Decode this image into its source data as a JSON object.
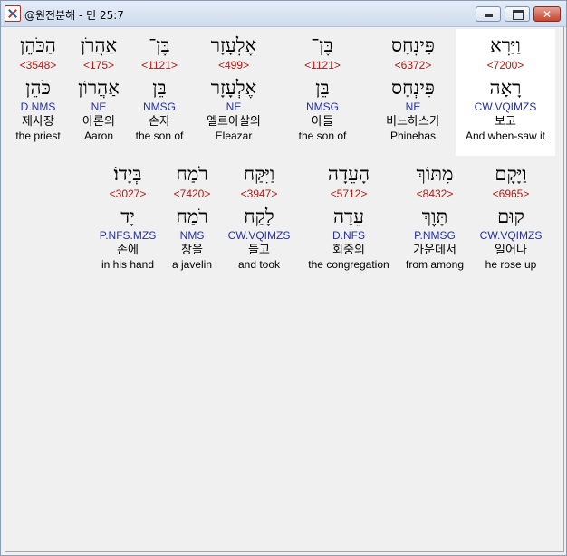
{
  "window": {
    "title": "@원전분해 - 민 25:7",
    "minimize_glyph": "",
    "maximize_glyph": "",
    "close_glyph": "✕"
  },
  "verse": {
    "line1": [
      {
        "heb": "וַיַּרְא",
        "strong": "<7200>",
        "lemma": "רָאָה",
        "parse": "CW.VQIMZS",
        "kor": "보고",
        "eng": "And when-saw it"
      },
      {
        "heb": "פִּינְחָס",
        "strong": "<6372>",
        "lemma": "פִּינְחָס",
        "parse": "NE",
        "kor": "비느하스가",
        "eng": "Phinehas"
      },
      {
        "heb": "בֶּן־",
        "strong": "<1121>",
        "lemma": "בֵּן",
        "parse": "NMSG",
        "kor": "아들",
        "eng": "the son of"
      },
      {
        "heb": "אֶלְעָזָר",
        "strong": "<499>",
        "lemma": "אֶלְעָזָר",
        "parse": "NE",
        "kor": "엘르아살의",
        "eng": "Eleazar"
      },
      {
        "heb": "בֶּן־",
        "strong": "<1121>",
        "lemma": "בֵּן",
        "parse": "NMSG",
        "kor": "손자",
        "eng": "the son of"
      },
      {
        "heb": "אַהֲרֹן",
        "strong": "<175>",
        "lemma": "אַהֲרוֹן",
        "parse": "NE",
        "kor": "아론의",
        "eng": "Aaron"
      },
      {
        "heb": "הַכֹּהֵן",
        "strong": "<3548>",
        "lemma": "כֹּהֵן",
        "parse": "D.NMS",
        "kor": "제사장",
        "eng": "the priest"
      }
    ],
    "line2": [
      {
        "heb": "וַיָּקָם",
        "strong": "<6965>",
        "lemma": "קוּם",
        "parse": "CW.VQIMZS",
        "kor": "일어나",
        "eng": "he rose up"
      },
      {
        "heb": "מִתּוֹךְ",
        "strong": "<8432>",
        "lemma": "תָּוֶךְ",
        "parse": "P.NMSG",
        "kor": "가운데서",
        "eng": "from among"
      },
      {
        "heb": "הָעֵדָה",
        "strong": "<5712>",
        "lemma": "עֵדָה",
        "parse": "D.NFS",
        "kor": "회중의",
        "eng": "the congregation"
      },
      {
        "heb": "וַיִּקַּח",
        "strong": "<3947>",
        "lemma": "לָקַח",
        "parse": "CW.VQIMZS",
        "kor": "들고",
        "eng": "and took"
      },
      {
        "heb": "רֹמַח",
        "strong": "<7420>",
        "lemma": "רֹמַח",
        "parse": "NMS",
        "kor": "창을",
        "eng": "a javelin"
      },
      {
        "heb": "בְּיָדוֹ׃",
        "strong": "<3027>",
        "lemma": "יָד",
        "parse": "P.NFS.MZS",
        "kor": "손에",
        "eng": "in his hand"
      }
    ]
  }
}
